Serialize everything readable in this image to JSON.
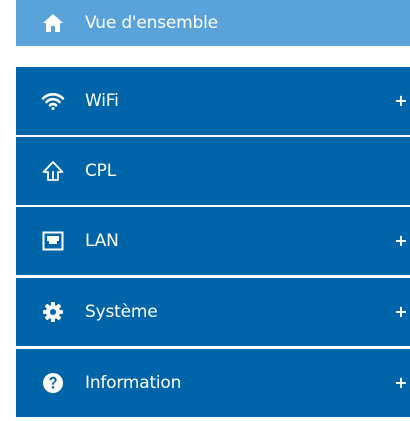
{
  "menu": {
    "items": [
      {
        "label": "Vue d'ensemble",
        "icon": "home-icon",
        "active": true,
        "expandable": false
      },
      {
        "label": "WiFi",
        "icon": "wifi-icon",
        "active": false,
        "expandable": true,
        "expand_symbol": "+"
      },
      {
        "label": "CPL",
        "icon": "powerline-icon",
        "active": false,
        "expandable": false
      },
      {
        "label": "LAN",
        "icon": "ethernet-port-icon",
        "active": false,
        "expandable": true,
        "expand_symbol": "+"
      },
      {
        "label": "Système",
        "icon": "gear-icon",
        "active": false,
        "expandable": true,
        "expand_symbol": "+"
      },
      {
        "label": "Information",
        "icon": "question-circle-icon",
        "active": false,
        "expandable": true,
        "expand_symbol": "+"
      }
    ]
  },
  "colors": {
    "active_background": "#5aa3da",
    "item_background": "#0064a8",
    "separator": "#ffffff",
    "text": "#ffffff"
  }
}
